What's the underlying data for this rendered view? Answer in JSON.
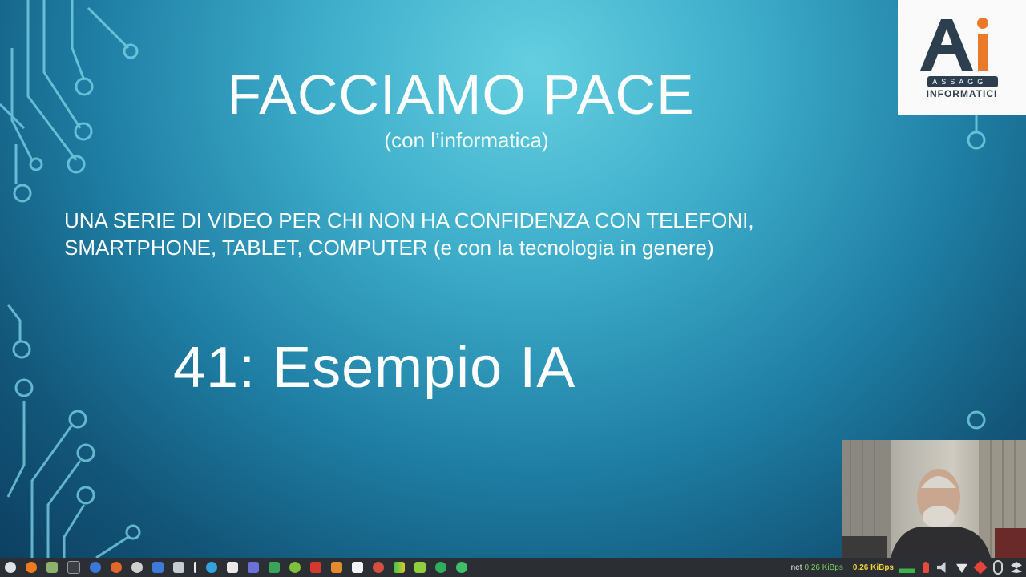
{
  "slide": {
    "title": "FACCIAMO PACE",
    "subtitle": "(con l’informatica)",
    "description_line1": "UNA SERIE DI VIDEO PER CHI NON HA CONFIDENZA CON TELEFONI,",
    "description_line2": "SMARTPHONE, TABLET, COMPUTER (e con la tecnologia in genere)",
    "episode": "41: Esempio IA"
  },
  "logo": {
    "line1": "ASSAGGI",
    "line2": "INFORMATICI"
  },
  "taskbar": {
    "net_label": "net",
    "net_up": "0.26 KiBps",
    "net_down": "0.26 KiBps",
    "apps": [
      "menu-icon",
      "firefox-icon",
      "files-icon",
      "terminal-icon",
      "chromium-icon",
      "browser-icon",
      "settings-icon",
      "docs-icon",
      "editor-icon",
      "text-cursor-icon",
      "telegram-icon",
      "media-icon",
      "discord-icon",
      "spreadsheet-icon",
      "globe-icon",
      "vscode-icon",
      "package-icon",
      "document-icon",
      "image-icon",
      "audio-meter-icon",
      "chip-icon",
      "sync-icon",
      "headset-icon"
    ]
  },
  "colors": {
    "slide_light": "#64cfe0",
    "slide_dark": "#0d4062",
    "logo_text": "#2d3e4e",
    "logo_accent": "#e9792b",
    "taskbar": "#2b2f33"
  }
}
